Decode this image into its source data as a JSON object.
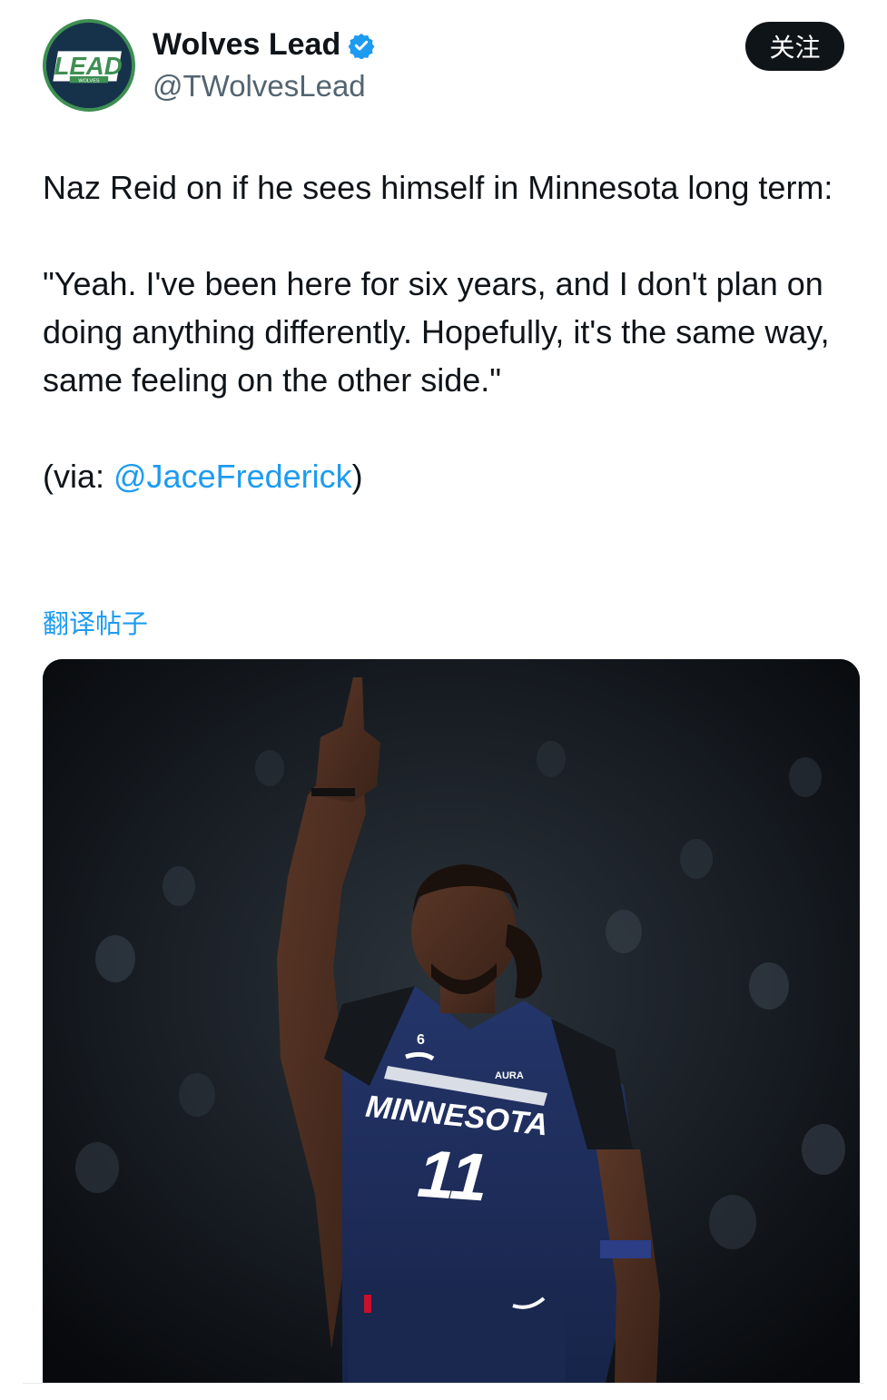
{
  "author": {
    "display_name": "Wolves Lead",
    "handle": "@TWolvesLead",
    "avatar_text": "LEAD",
    "avatar_subtext": "WOLVES",
    "verified": true
  },
  "follow_button": {
    "label": "关注"
  },
  "tweet": {
    "para1": "Naz Reid on if he sees himself in Minnesota long term:",
    "para2": "\"Yeah. I've been here for six years, and I don't plan on doing anything differently. Hopefully, it's the same way, same feeling on the other side.\"",
    "via_prefix": "(via: ",
    "via_mention": "@JaceFrederick",
    "via_suffix": ")"
  },
  "translate_label": "翻译帖子",
  "media": {
    "jersey_text": "MINNESOTA",
    "jersey_number": "11",
    "patch_number": "6",
    "sponsor_text": "AURA"
  },
  "colors": {
    "link": "#1d9bf0",
    "text": "#0f1419",
    "secondary": "#536471",
    "follow_bg": "#0f1419",
    "jersey": "#1e2d58"
  }
}
